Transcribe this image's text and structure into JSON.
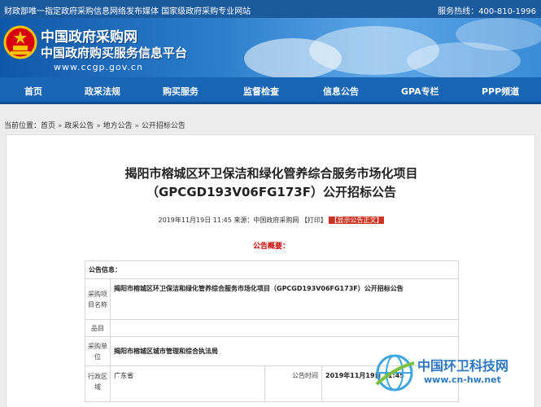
{
  "topbar": {
    "left": "财政部唯一指定政府采购信息网络发布媒体 国家级政府采购专业网站",
    "hotline": "服务热线：400-810-1996"
  },
  "header": {
    "site_name": "中国政府采购网",
    "site_subtitle": "中国政府购买服务信息平台",
    "site_url": "www.ccgp.gov.cn"
  },
  "nav": [
    "首页",
    "政采法规",
    "购买服务",
    "监督检查",
    "信息公告",
    "GPA专栏",
    "PPP频道"
  ],
  "breadcrumb": {
    "prefix": "当前位置：",
    "items": [
      "首页",
      "政采公告",
      "地方公告",
      "公开招标公告"
    ],
    "sep": "»"
  },
  "article": {
    "title_line1": "揭阳市榕城区环卫保洁和绿化管养综合服务市场化项目",
    "title_line2": "（GPCGD193V06FG173F）公开招标公告",
    "date": "2019年11月19日 11:45",
    "source": "来源：中国政府采购网",
    "print": "【打印】",
    "show_text": "【显示公告正文】",
    "summary_title": "公告概要："
  },
  "info_table": {
    "header": "公告信息：",
    "project_label": "采购项目名称",
    "project_value": "揭阳市榕城区环卫保洁和绿化管养综合服务市场化项目（GPCGD193V06FG173F）公开招标公告",
    "item_label": "品目",
    "item_value": "",
    "unit_label": "采购单位",
    "unit_value": "揭阳市榕城区城市管理和综合执法局",
    "region_label": "行政区域",
    "region_value": "广东省",
    "time_label": "公告时间",
    "time_value": "2019年11月19日 11:45"
  },
  "watermark": {
    "name": "中国环卫科技网",
    "url": "www.cn-hw.net"
  },
  "colors": {
    "topbar": "#1c5a9e",
    "nav": "#1765b4",
    "accent_red": "#c00",
    "watermark_blue": "#2f79c0"
  }
}
